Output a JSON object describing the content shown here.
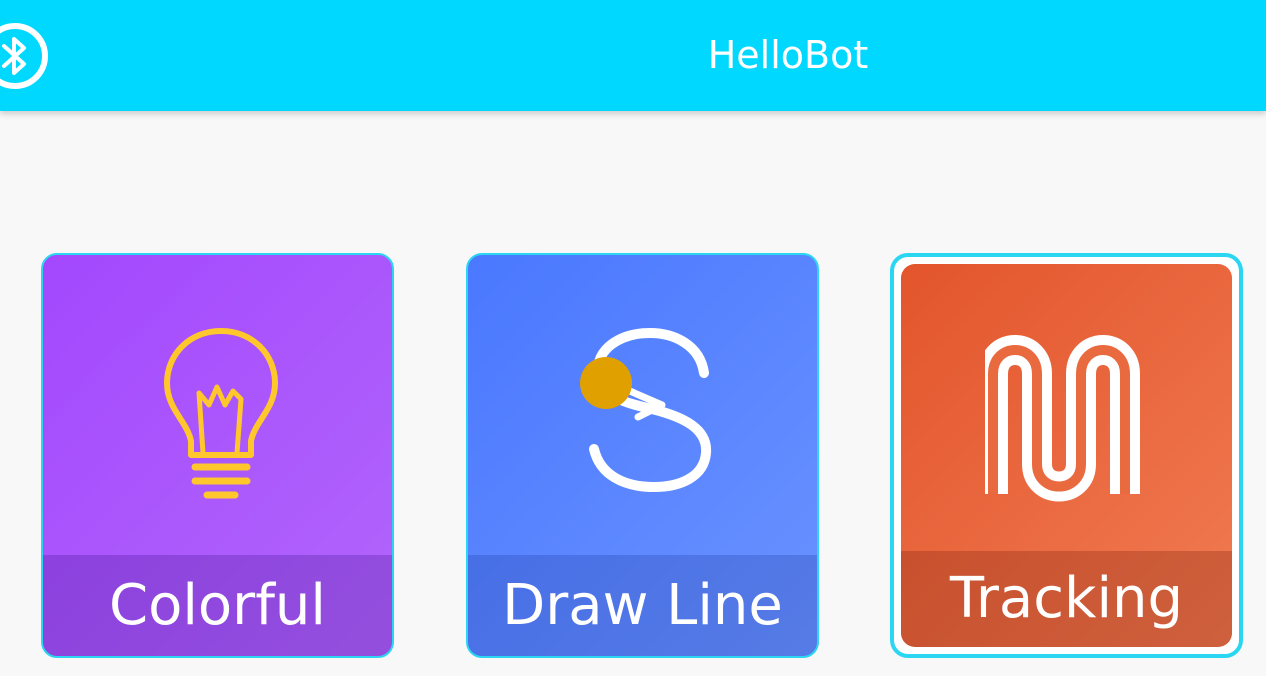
{
  "appbar": {
    "title": "HelloBot",
    "bluetooth_icon": "bluetooth-icon",
    "background": "#00d8ff"
  },
  "cards": [
    {
      "label": "Colorful",
      "icon": "lightbulb-icon",
      "color": "#a348fe"
    },
    {
      "label": "Draw Line",
      "icon": "draw-line-icon",
      "color": "#4a78ff"
    },
    {
      "label": "Tracking",
      "icon": "track-path-icon",
      "color": "#e3552c",
      "selected": true
    }
  ],
  "colors": {
    "card_border": "#2ad6f2",
    "bulb": "#ffc72c",
    "dot": "#e0a000"
  }
}
